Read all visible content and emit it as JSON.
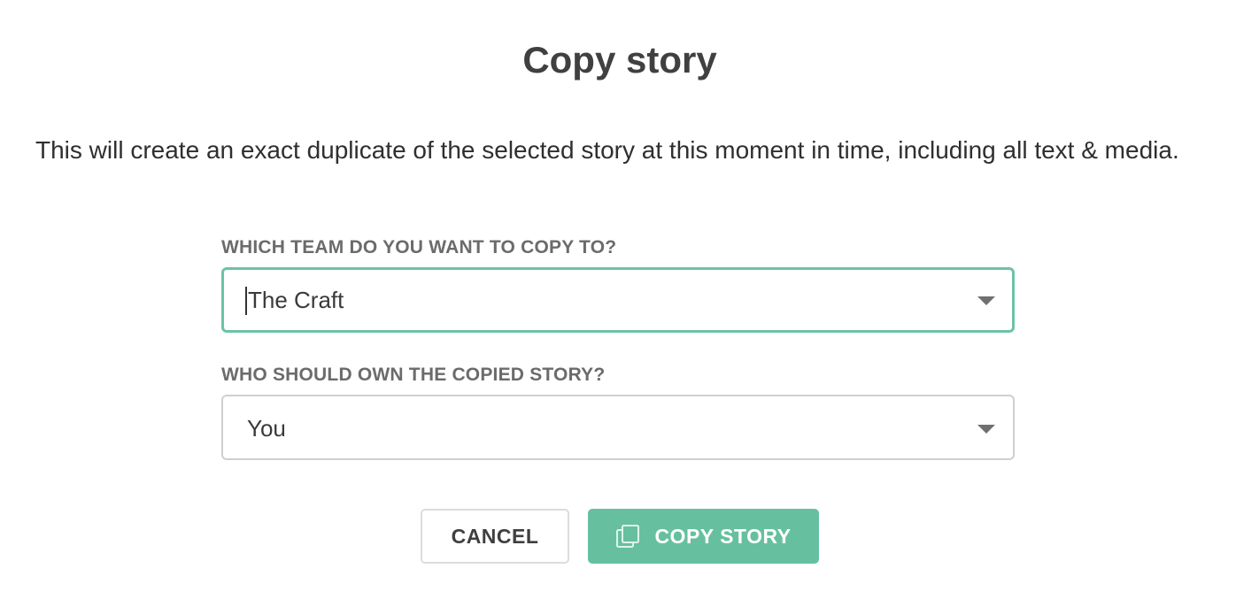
{
  "dialog": {
    "title": "Copy story",
    "description": "This will create an exact duplicate of the selected story at this moment in time, including all text & media."
  },
  "team_field": {
    "label": "WHICH TEAM DO YOU WANT TO COPY TO?",
    "value": "The Craft",
    "icon": "chevron-down-icon"
  },
  "owner_field": {
    "label": "WHO SHOULD OWN THE COPIED STORY?",
    "value": "You",
    "icon": "chevron-down-icon"
  },
  "actions": {
    "cancel_label": "CANCEL",
    "copy_label": "COPY STORY",
    "copy_icon": "copy-icon"
  },
  "colors": {
    "accent": "#66c09f",
    "focus_border": "#6cc3a3",
    "text": "#3a3a3a"
  }
}
